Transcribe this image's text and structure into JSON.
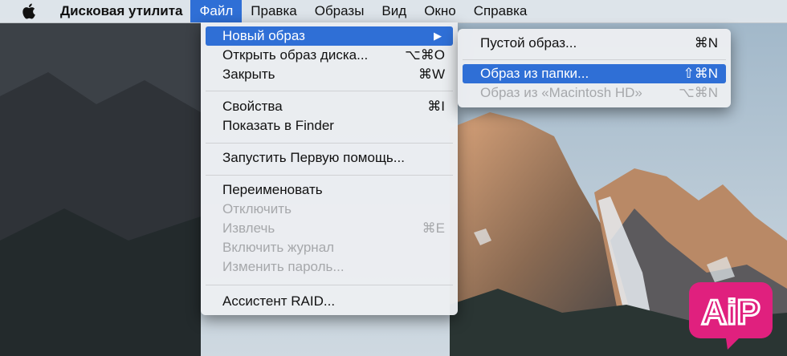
{
  "menubar": {
    "app_name": "Дисковая утилита",
    "items": [
      "Файл",
      "Правка",
      "Образы",
      "Вид",
      "Окно",
      "Справка"
    ]
  },
  "file_menu": {
    "new_image": "Новый образ",
    "open_image": {
      "label": "Открыть образ диска...",
      "shortcut": "⌥⌘O"
    },
    "close": {
      "label": "Закрыть",
      "shortcut": "⌘W"
    },
    "properties": {
      "label": "Свойства",
      "shortcut": "⌘I"
    },
    "show_in_finder": "Показать в Finder",
    "first_aid": "Запустить Первую помощь...",
    "rename": "Переименовать",
    "unmount": "Отключить",
    "eject": {
      "label": "Извлечь",
      "shortcut": "⌘E"
    },
    "enable_journal": "Включить журнал",
    "change_password": "Изменить пароль...",
    "raid_assistant": "Ассистент RAID..."
  },
  "new_image_submenu": {
    "blank": {
      "label": "Пустой образ...",
      "shortcut": "⌘N"
    },
    "from_folder": {
      "label": "Образ из папки...",
      "shortcut": "⇧⌘N"
    },
    "from_volume": {
      "label": "Образ из «Macintosh HD»",
      "shortcut": "⌥⌘N"
    }
  },
  "logo": {
    "text": "AiP"
  },
  "colors": {
    "highlight": "#2f6fd6",
    "logo_pink": "#e0207e",
    "disabled_text": "#a6a8ab"
  }
}
